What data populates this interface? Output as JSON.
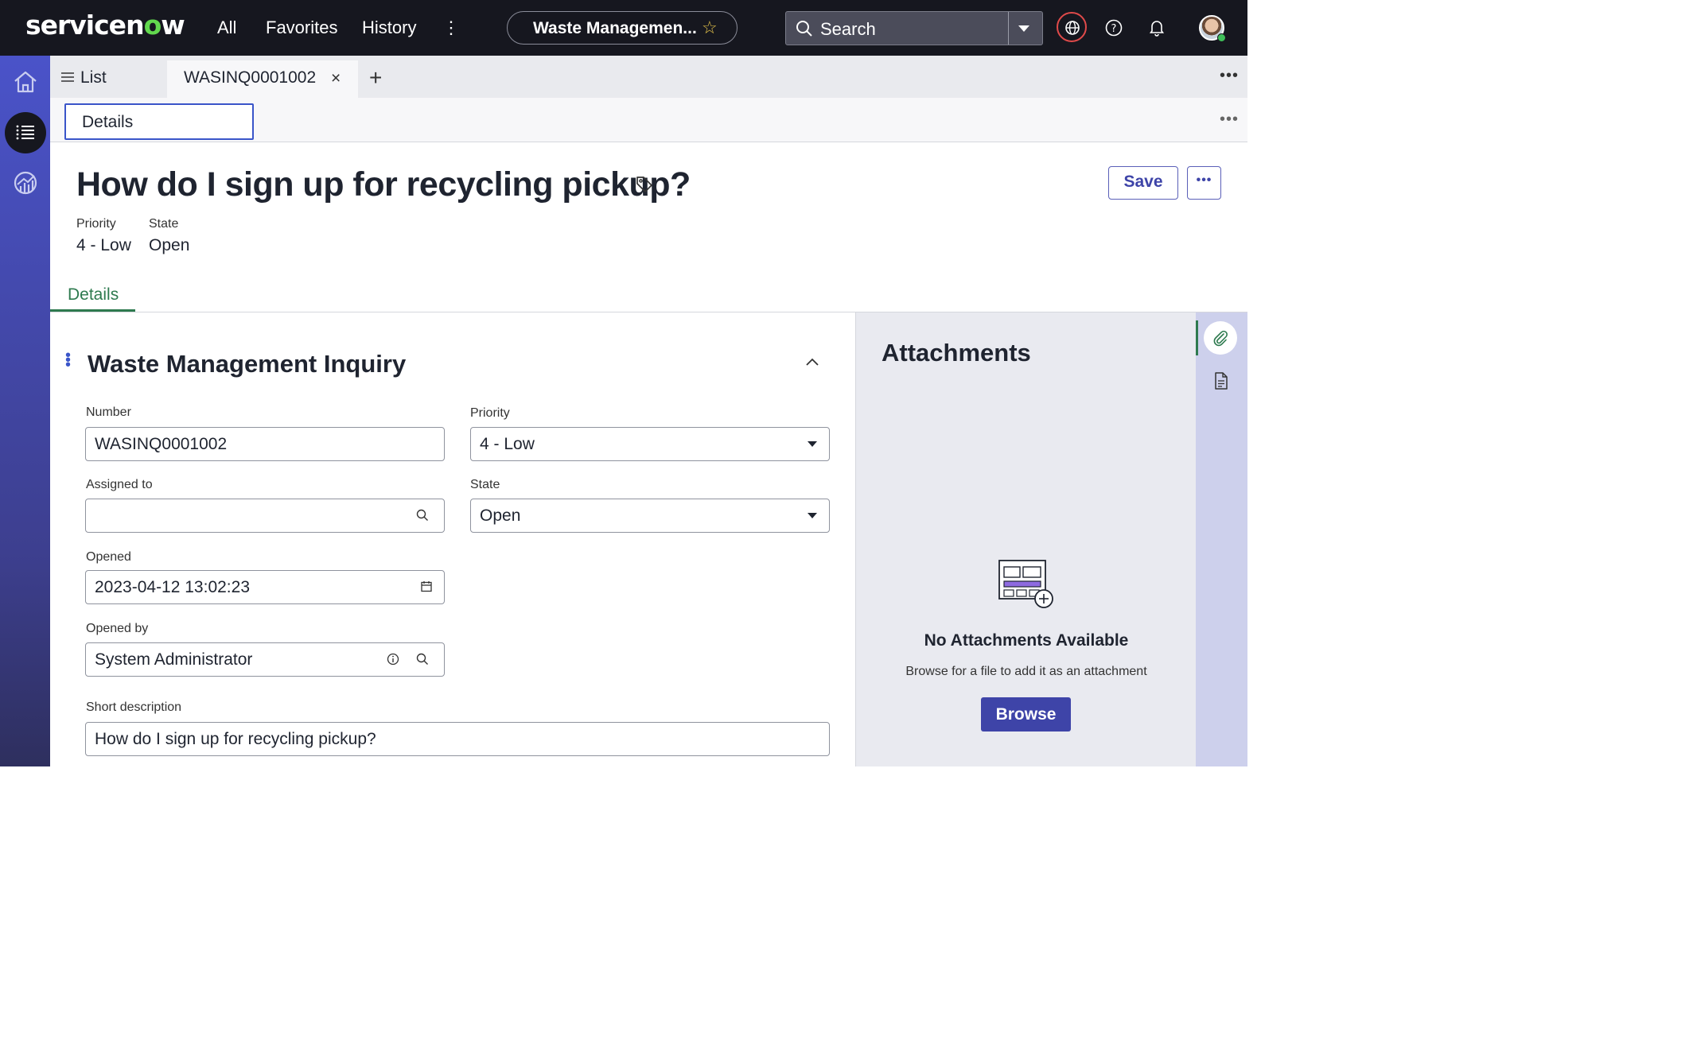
{
  "topbar": {
    "logo_text_pre": "servicen",
    "logo_text_o": "o",
    "logo_text_post": "w",
    "nav": [
      "All",
      "Favorites",
      "History"
    ],
    "app_pill": "Waste Managemen...",
    "search_placeholder": "Search"
  },
  "tabs": {
    "list_label": "List",
    "active_label": "WASINQ0001002",
    "sub_tab": "Details"
  },
  "record": {
    "title": "How do I sign up for recycling pickup?",
    "save_label": "Save",
    "meta": [
      {
        "label": "Priority",
        "value": "4 - Low"
      },
      {
        "label": "State",
        "value": "Open"
      }
    ],
    "form_tab": "Details"
  },
  "section": {
    "title": "Waste Management Inquiry",
    "fields": {
      "number": {
        "label": "Number",
        "value": "WASINQ0001002"
      },
      "priority": {
        "label": "Priority",
        "value": "4 - Low"
      },
      "assigned_to": {
        "label": "Assigned to",
        "value": ""
      },
      "state": {
        "label": "State",
        "value": "Open"
      },
      "opened": {
        "label": "Opened",
        "value": "2023-04-12 13:02:23"
      },
      "opened_by": {
        "label": "Opened by",
        "value": "System Administrator"
      },
      "short_description": {
        "label": "Short description",
        "value": "How do I sign up for recycling pickup?"
      }
    }
  },
  "attachments": {
    "title": "Attachments",
    "empty_title": "No Attachments Available",
    "empty_hint": "Browse for a file to add it as an attachment",
    "browse_label": "Browse"
  },
  "colors": {
    "topbar_bg": "#16171f",
    "accent": "#3e44a8",
    "active_tab_green": "#2e7a4f",
    "logo_o": "#62d84e"
  }
}
